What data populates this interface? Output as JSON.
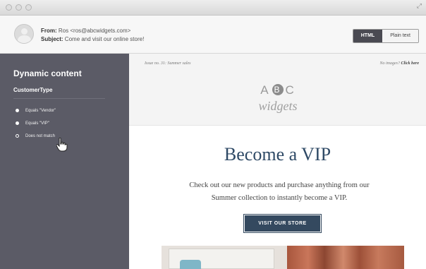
{
  "window": {
    "controls": [
      "close",
      "minimize",
      "zoom"
    ]
  },
  "header": {
    "from_label": "From:",
    "from_value": "Ros <ros@abcwidgets.com>",
    "subject_label": "Subject:",
    "subject_value": "Come and visit our online store!",
    "view_toggle": {
      "html_label": "HTML",
      "plain_label": "Plain text",
      "selected": "HTML"
    }
  },
  "sidebar": {
    "title": "Dynamic content",
    "field": "CustomerType",
    "options": [
      {
        "label": "Equals \"Vendor\"",
        "selected": false
      },
      {
        "label": "Equals \"VIP\"",
        "selected": false
      },
      {
        "label": "Does not match",
        "selected": true
      }
    ]
  },
  "newsletter": {
    "issue": "Issue no. 31: Summer sales",
    "no_images_text": "No images?",
    "no_images_link": "Click here",
    "logo_top": "A B C",
    "logo_letters": [
      "A",
      "B",
      "C"
    ],
    "logo_sub": "widgets",
    "headline": "Become a VIP",
    "body": "Check out our new products and purchase anything from our Summer collection to instantly become a VIP.",
    "cta_label": "VISIT OUR STORE"
  }
}
